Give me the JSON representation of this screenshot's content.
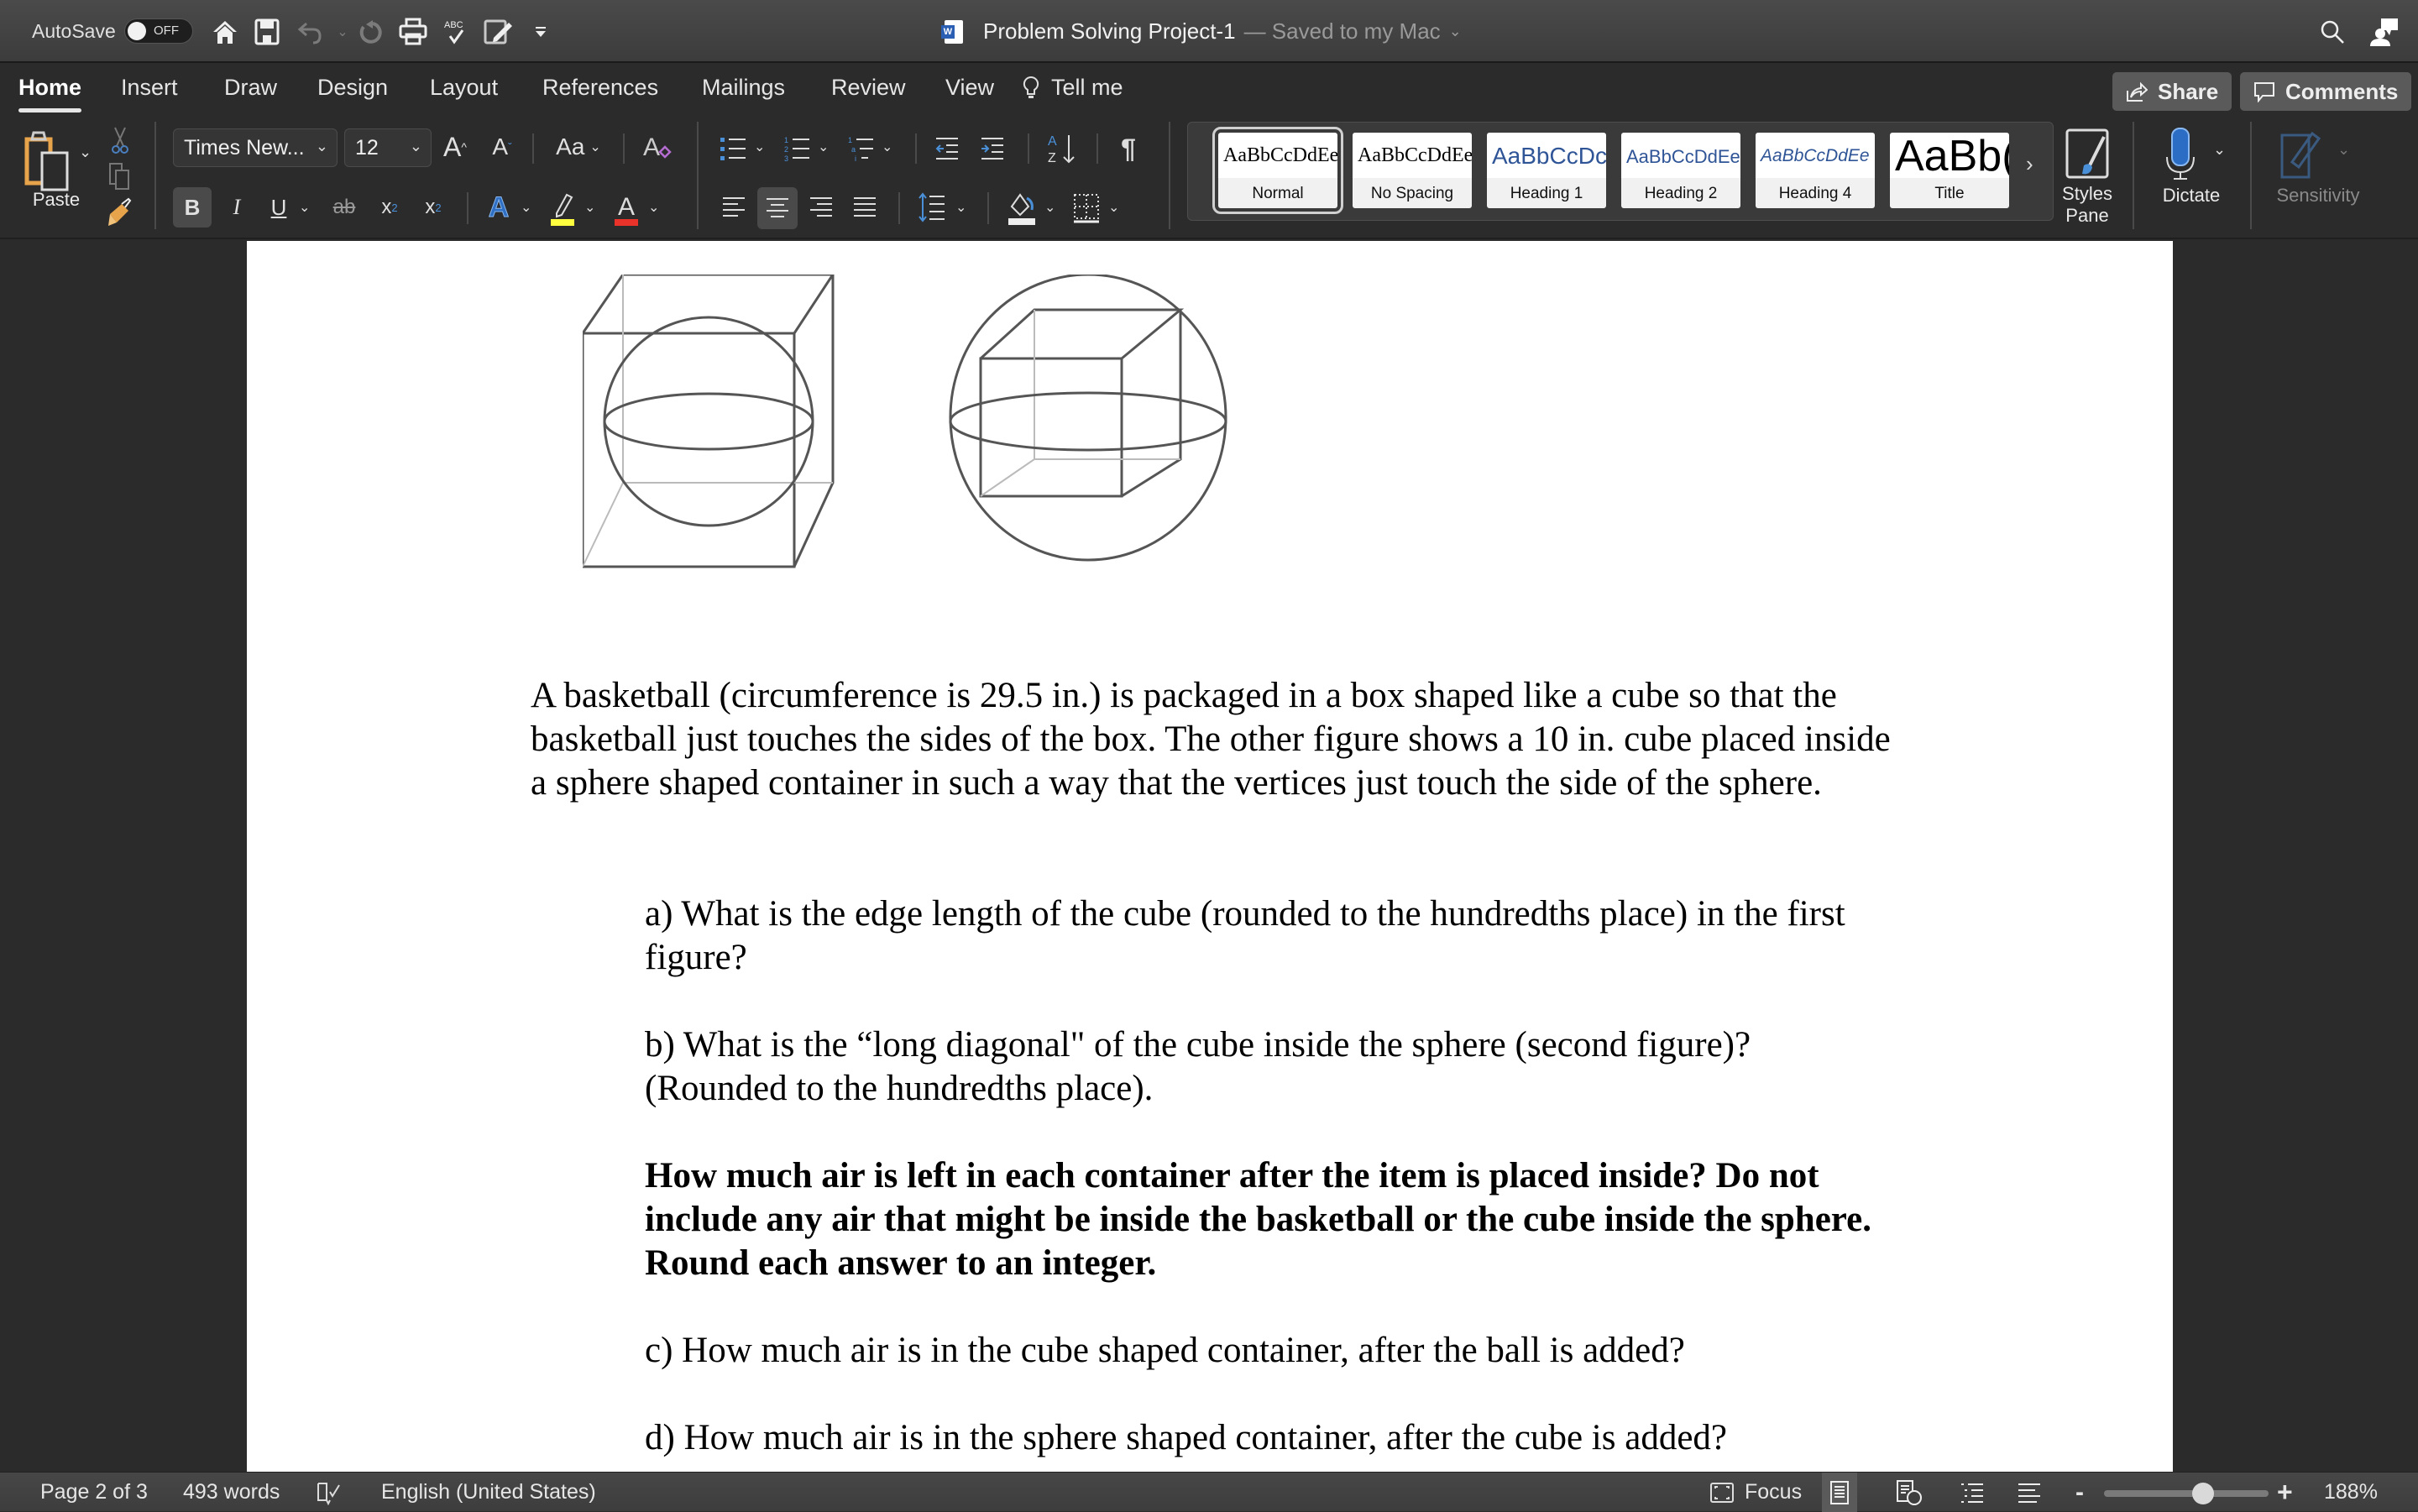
{
  "titlebar": {
    "autosave_label": "AutoSave",
    "autosave_state": "OFF",
    "doc_name": "Problem Solving Project-1",
    "save_status": "— Saved to my Mac",
    "quick_access": [
      "home-icon",
      "save-icon",
      "undo-icon",
      "redo-icon",
      "print-icon",
      "spelling-check-icon",
      "edit-document-icon",
      "customize-toolbar-icon"
    ]
  },
  "tabs": [
    {
      "label": "Home",
      "active": true
    },
    {
      "label": "Insert"
    },
    {
      "label": "Draw"
    },
    {
      "label": "Design"
    },
    {
      "label": "Layout"
    },
    {
      "label": "References"
    },
    {
      "label": "Mailings"
    },
    {
      "label": "Review"
    },
    {
      "label": "View"
    },
    {
      "label": "Tell me"
    }
  ],
  "header_buttons": {
    "share": "Share",
    "comments": "Comments"
  },
  "ribbon": {
    "paste_label": "Paste",
    "font_name": "Times New...",
    "font_size": "12",
    "change_case": "Aa",
    "styles": [
      {
        "sample": "AaBbCcDdEe",
        "name": "Normal",
        "selected": true
      },
      {
        "sample": "AaBbCcDdEe",
        "name": "No Spacing"
      },
      {
        "sample": "AaBbCcDc",
        "name": "Heading 1"
      },
      {
        "sample": "AaBbCcDdEe",
        "name": "Heading 2"
      },
      {
        "sample": "AaBbCcDdEe",
        "name": "Heading 4"
      },
      {
        "sample": "AaBb(",
        "name": "Title"
      }
    ],
    "styles_pane": "Styles Pane",
    "dictate": "Dictate",
    "sensitivity": "Sensitivity",
    "colors": {
      "highlight": "#ffff40",
      "font_color": "#e8322a",
      "accent_blue": "#4a90d9"
    }
  },
  "document": {
    "intro": "A basketball (circumference is 29.5 in.) is packaged in a box shaped like a cube so that the basketball just touches the sides of the box.   The other figure shows a 10 in. cube placed inside a sphere shaped container in such a way that the vertices just touch the side of the sphere.",
    "q_a": "a) What is the edge length of the cube (rounded to the hundredths place) in the first figure?",
    "q_b": "b) What is the  “long diagonal\" of the cube inside the sphere (second figure)? (Rounded to the hundredths place).",
    "instruction": "How much air is left in each container after the item is placed inside?  Do not include any air that might be inside the basketball or the cube inside the sphere.  Round each answer to an integer.",
    "q_c": "c) How much air is in the cube shaped container, after the ball is added?",
    "q_d": "d) How much air is in the sphere shaped container, after the cube is added?"
  },
  "status": {
    "page": "Page 2 of 3",
    "words": "493 words",
    "language": "English (United States)",
    "focus": "Focus",
    "zoom": "188%",
    "zoom_slider_fraction": 0.6
  }
}
